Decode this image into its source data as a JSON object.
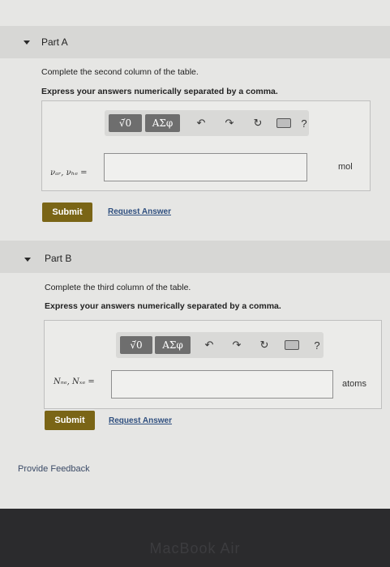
{
  "partA": {
    "title": "Part A",
    "instruction": "Complete the second column of the table.",
    "express": "Express your answers numerically separated by a comma.",
    "toolbar": {
      "templates_label": "√̄0",
      "greek_label": "ΑΣφ",
      "help_label": "?"
    },
    "variable_label": "νₐᵣ, νₕₑ =",
    "answer_value": "",
    "unit": "mol",
    "submit_label": "Submit",
    "request_label": "Request Answer"
  },
  "partB": {
    "title": "Part B",
    "instruction": "Complete the third column of the table.",
    "express": "Express your answers numerically separated by a comma.",
    "toolbar": {
      "templates_label": "√̄0",
      "greek_label": "ΑΣφ",
      "help_label": "?"
    },
    "variable_label": "Nₙₑ, Nₓₑ =",
    "answer_value": "",
    "unit": "atoms",
    "submit_label": "Submit",
    "request_label": "Request Answer"
  },
  "feedback_label": "Provide Feedback",
  "bezel_label": "MacBook Air"
}
